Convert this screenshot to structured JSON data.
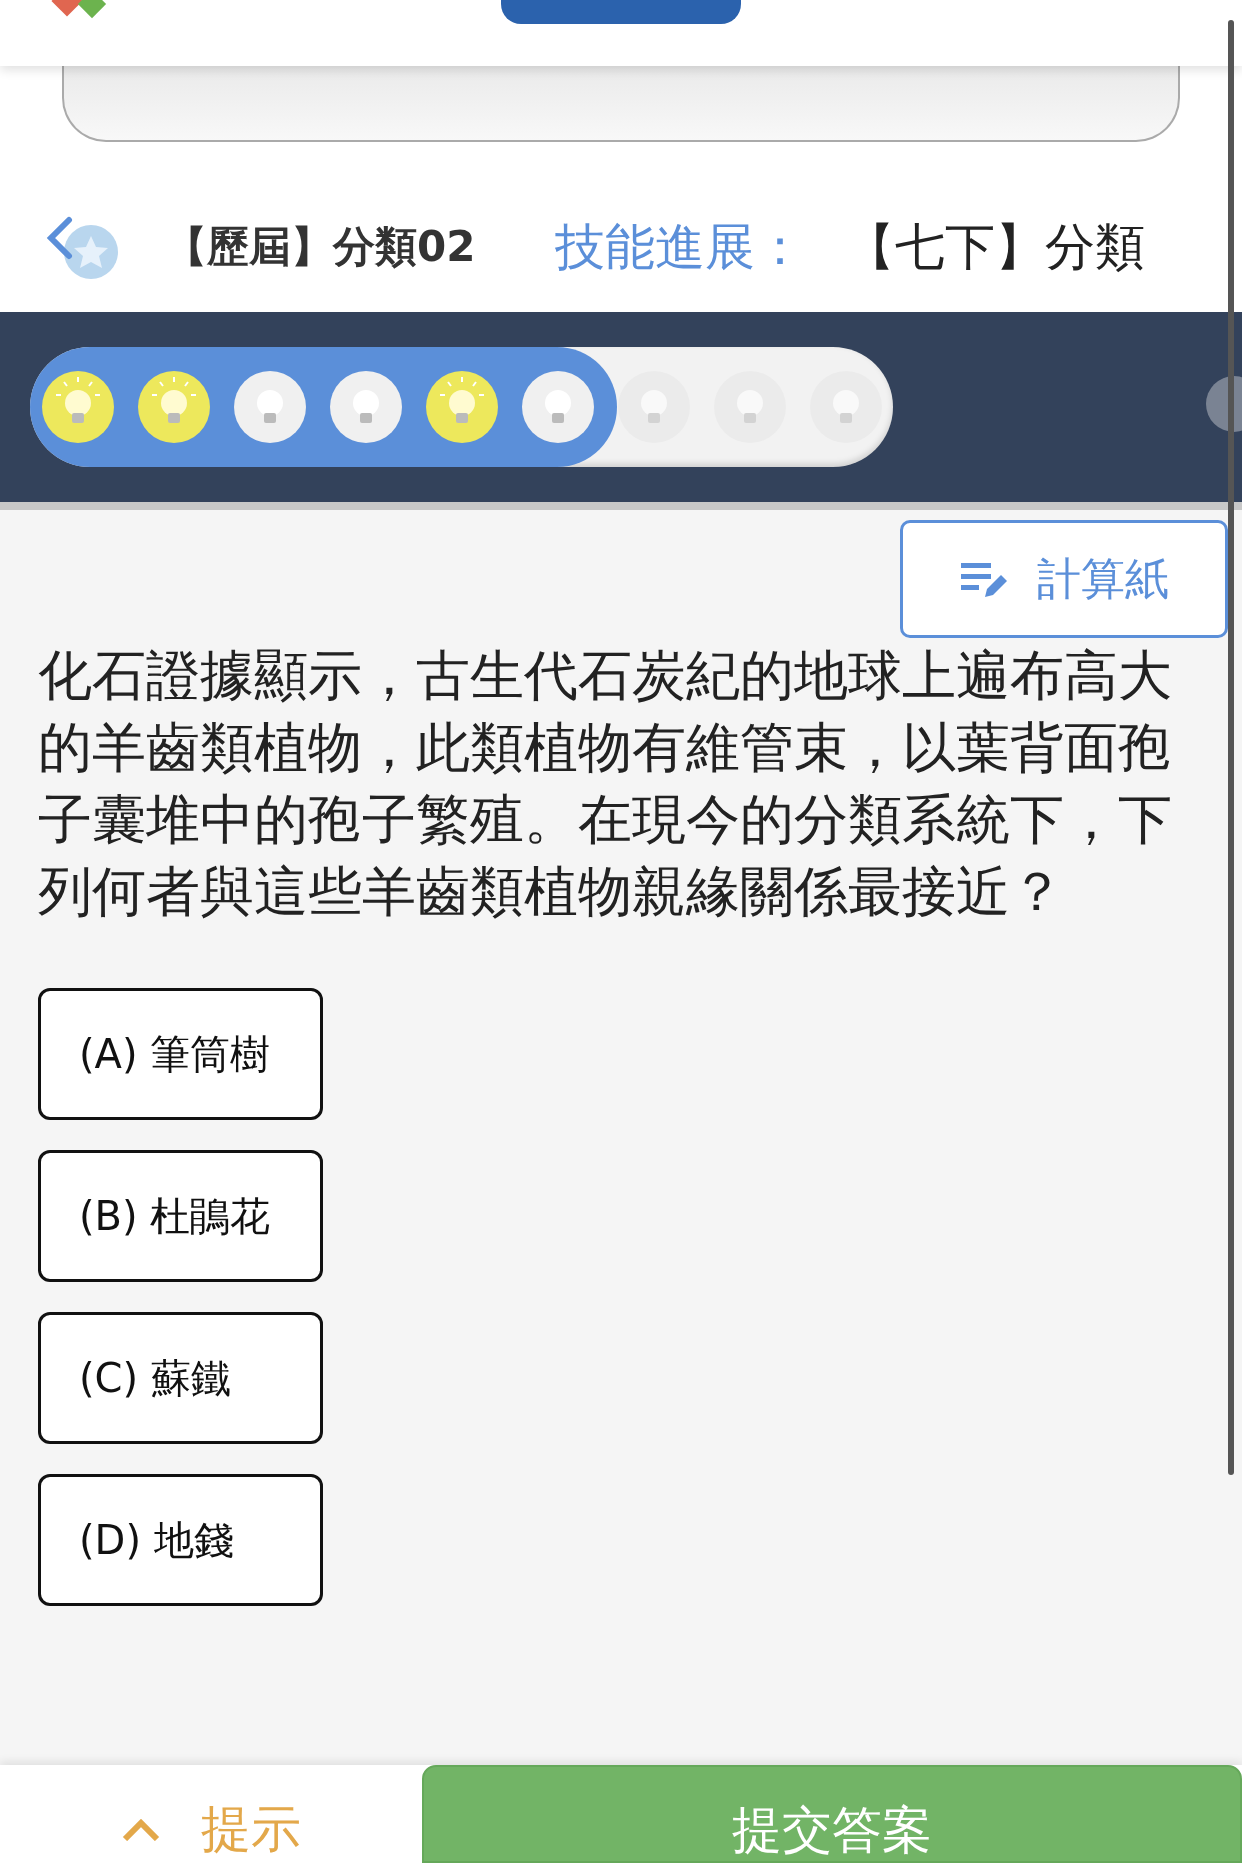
{
  "header": {
    "title": "【歷屆】分類02",
    "progress_label": "技能進展：",
    "skill": "【七下】分類"
  },
  "progress": {
    "level": 0.68,
    "bulbs": [
      {
        "lit": true,
        "answered": true
      },
      {
        "lit": true,
        "answered": true
      },
      {
        "lit": false,
        "answered": true
      },
      {
        "lit": false,
        "answered": true
      },
      {
        "lit": true,
        "answered": true
      },
      {
        "lit": false,
        "answered": true
      },
      {
        "lit": false,
        "answered": false
      },
      {
        "lit": false,
        "answered": false
      },
      {
        "lit": false,
        "answered": false
      }
    ]
  },
  "scratch_button": "計算紙",
  "question": "化石證據顯示，古生代石炭紀的地球上遍布高大的羊齒類植物，此類植物有維管束，以葉背面孢子囊堆中的孢子繁殖。在現今的分類系統下，下列何者與這些羊齒類植物親緣關係最接近？",
  "options": [
    {
      "label": "(A) 筆筒樹",
      "selected": false
    },
    {
      "label": "(B) 杜鵑花",
      "selected": false
    },
    {
      "label": "(C) 蘇鐵",
      "selected": false
    },
    {
      "label": "(D) 地錢",
      "selected": false
    }
  ],
  "footer": {
    "hint": "提示",
    "submit": "提交答案"
  }
}
